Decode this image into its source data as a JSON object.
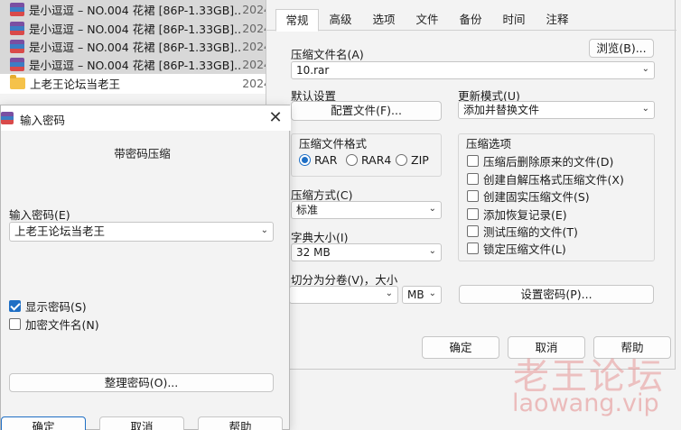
{
  "file_list": {
    "items": [
      {
        "name": "是小逗逗 – NO.004 花裙 [86P-1.33GB]...",
        "date": "2024",
        "type": "rar",
        "selected": true
      },
      {
        "name": "是小逗逗 – NO.004 花裙 [86P-1.33GB]...",
        "date": "2024",
        "type": "rar",
        "selected": true
      },
      {
        "name": "是小逗逗 – NO.004 花裙 [86P-1.33GB]...",
        "date": "2024",
        "type": "rar",
        "selected": true
      },
      {
        "name": "是小逗逗 – NO.004 花裙 [86P-1.33GB]...",
        "date": "2024",
        "type": "rar",
        "selected": true
      },
      {
        "name": "上老王论坛当老王",
        "date": "2024",
        "type": "folder",
        "selected": false
      }
    ]
  },
  "archive_dialog": {
    "tabs": [
      "常规",
      "高级",
      "选项",
      "文件",
      "备份",
      "时间",
      "注释"
    ],
    "active_tab": 0,
    "archive_name_label": "压缩文件名(A)",
    "browse_label": "浏览(B)...",
    "archive_name_value": "10.rar",
    "default_settings_label": "默认设置",
    "profiles_label": "配置文件(F)...",
    "update_mode_label": "更新模式(U)",
    "update_mode_value": "添加并替换文件",
    "format_group_label": "压缩文件格式",
    "format_options": [
      {
        "label": "RAR",
        "selected": true
      },
      {
        "label": "RAR4",
        "selected": false
      },
      {
        "label": "ZIP",
        "selected": false
      }
    ],
    "method_label": "压缩方式(C)",
    "method_value": "标准",
    "dict_size_label": "字典大小(I)",
    "dict_size_value": "32 MB",
    "split_label": "切分为分卷(V)，大小",
    "split_value": "",
    "split_unit": "MB",
    "options_group_label": "压缩选项",
    "options": [
      {
        "label": "压缩后删除原来的文件(D)",
        "checked": false
      },
      {
        "label": "创建自解压格式压缩文件(X)",
        "checked": false
      },
      {
        "label": "创建固实压缩文件(S)",
        "checked": false
      },
      {
        "label": "添加恢复记录(E)",
        "checked": false
      },
      {
        "label": "测试压缩的文件(T)",
        "checked": false
      },
      {
        "label": "锁定压缩文件(L)",
        "checked": false
      }
    ],
    "set_password_label": "设置密码(P)...",
    "ok_label": "确定",
    "cancel_label": "取消",
    "help_label": "帮助"
  },
  "password_dialog": {
    "title": "输入密码",
    "heading": "带密码压缩",
    "enter_password_label": "输入密码(E)",
    "password_value": "上老王论坛当老王",
    "show_password_label": "显示密码(S)",
    "show_password_checked": true,
    "encrypt_names_label": "加密文件名(N)",
    "encrypt_names_checked": false,
    "organize_label": "整理密码(O)...",
    "ok_label": "确定",
    "cancel_label": "取消",
    "help_label": "帮助"
  },
  "watermark": {
    "cn": "老王论坛",
    "en": "laowang.vip"
  },
  "colors": {
    "accent": "#1f6fc5",
    "selection": "#d8d8d8",
    "watermark": "#e69696"
  }
}
